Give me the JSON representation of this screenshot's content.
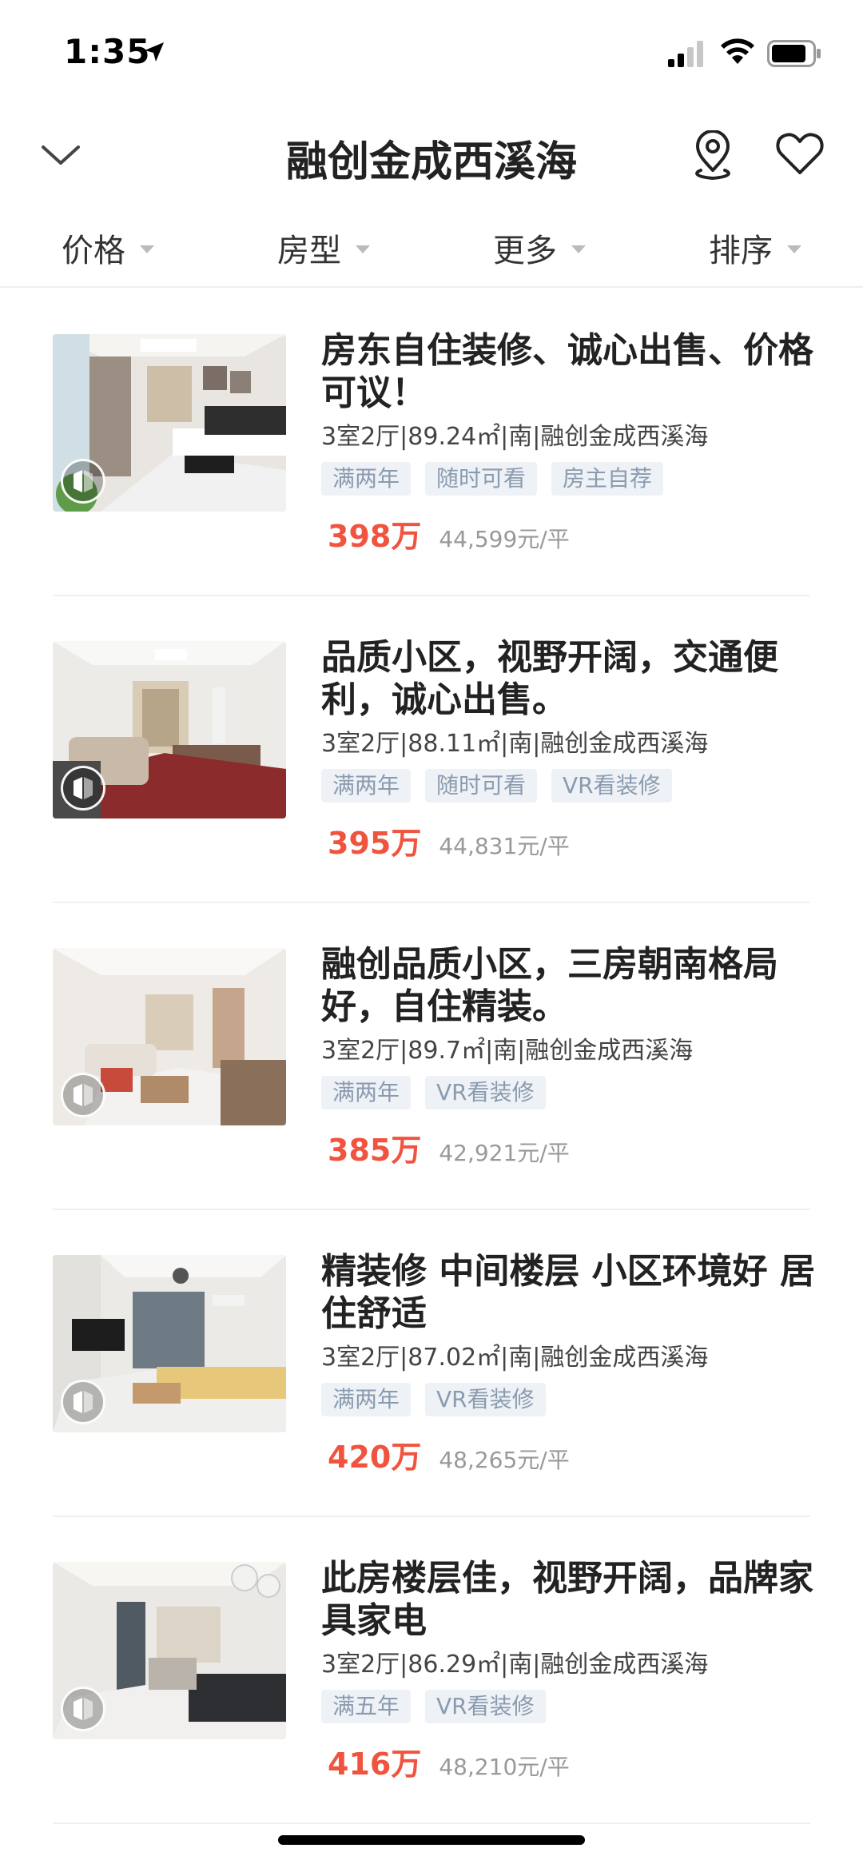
{
  "status_bar": {
    "time": "1:35"
  },
  "nav": {
    "title": "融创金成西溪海"
  },
  "filters": [
    {
      "label": "价格"
    },
    {
      "label": "房型"
    },
    {
      "label": "更多"
    },
    {
      "label": "排序"
    }
  ],
  "listings": [
    {
      "title": "房东自住装修、诚心出售、价格可议！",
      "meta": "3室2厅|89.24㎡|南|融创金成西溪海",
      "tags": [
        "满两年",
        "随时可看",
        "房主自荐"
      ],
      "price": "398万",
      "unit_price": "44,599元/平"
    },
    {
      "title": "品质小区，视野开阔，交通便利，诚心出售。",
      "meta": "3室2厅|88.11㎡|南|融创金成西溪海",
      "tags": [
        "满两年",
        "随时可看",
        "VR看装修"
      ],
      "price": "395万",
      "unit_price": "44,831元/平"
    },
    {
      "title": "融创品质小区，三房朝南格局好，自住精装。",
      "meta": "3室2厅|89.7㎡|南|融创金成西溪海",
      "tags": [
        "满两年",
        "VR看装修"
      ],
      "price": "385万",
      "unit_price": "42,921元/平"
    },
    {
      "title": "精装修 中间楼层 小区环境好 居住舒适",
      "meta": "3室2厅|87.02㎡|南|融创金成西溪海",
      "tags": [
        "满两年",
        "VR看装修"
      ],
      "price": "420万",
      "unit_price": "48,265元/平"
    },
    {
      "title": "此房楼层佳，视野开阔，品牌家具家电",
      "meta": "3室2厅|86.29㎡|南|融创金成西溪海",
      "tags": [
        "满五年",
        "VR看装修"
      ],
      "price": "416万",
      "unit_price": "48,210元/平"
    }
  ]
}
